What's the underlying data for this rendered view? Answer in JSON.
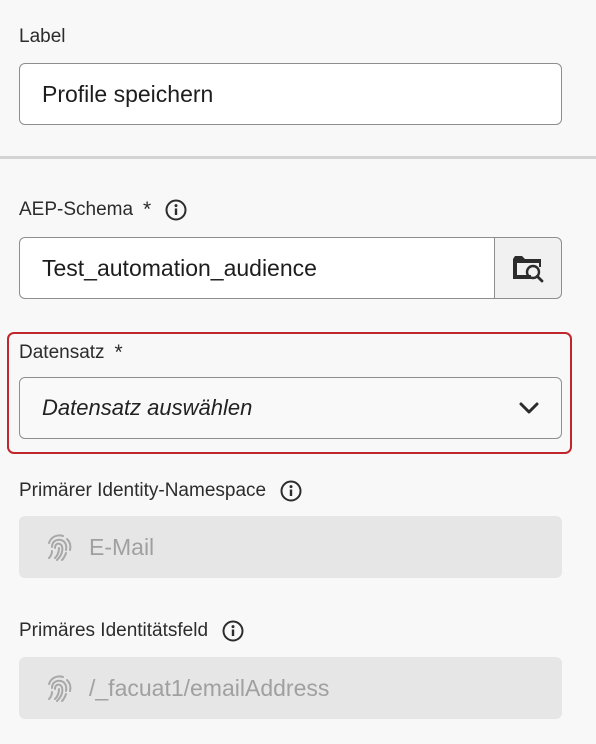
{
  "label_field": {
    "label": "Label",
    "value": "Profile speichern"
  },
  "schema_field": {
    "label": "AEP-Schema",
    "required_mark": "*",
    "value": "Test_automation_audience",
    "browse_icon": "folder-search-icon",
    "info_icon": "info-icon"
  },
  "dataset_field": {
    "label": "Datensatz",
    "required_mark": "*",
    "placeholder": "Datensatz auswählen",
    "highlight_color": "#c0272d"
  },
  "primary_namespace_field": {
    "label": "Primärer Identity-Namespace",
    "value": "E-Mail",
    "icon": "fingerprint-icon"
  },
  "primary_identity_field": {
    "label": "Primäres Identitätsfeld",
    "value": "/_facuat1/emailAddress",
    "icon": "fingerprint-icon"
  }
}
